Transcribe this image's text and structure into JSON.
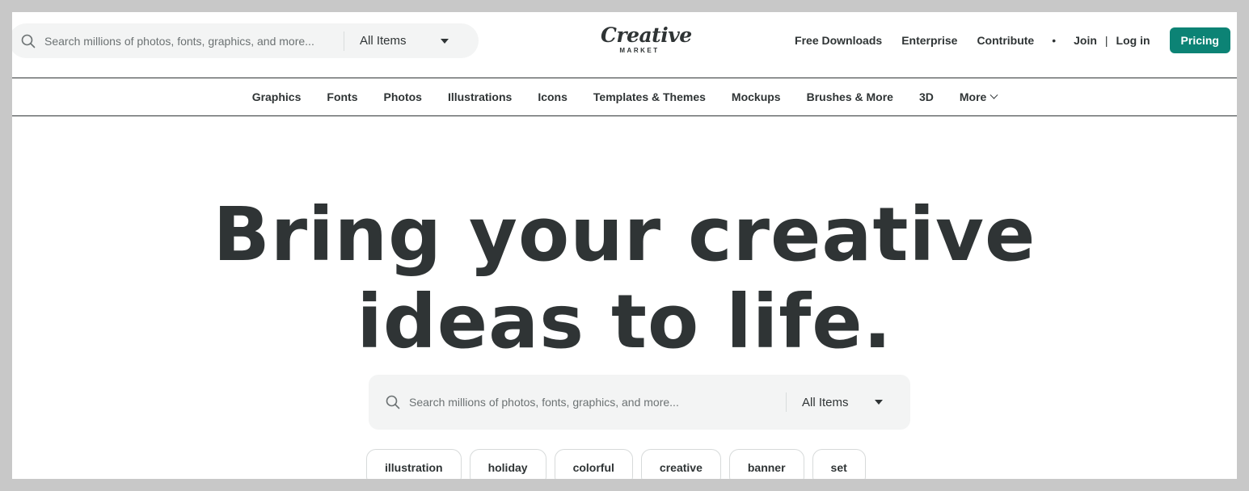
{
  "header": {
    "search": {
      "placeholder": "Search millions of photos, fonts, graphics, and more...",
      "category": "All Items"
    },
    "logo": {
      "main": "Creative",
      "sub": "MARKET"
    },
    "links": {
      "free_downloads": "Free Downloads",
      "enterprise": "Enterprise",
      "contribute": "Contribute",
      "dot": "•",
      "join": "Join",
      "pipe": "|",
      "login": "Log in",
      "pricing": "Pricing"
    }
  },
  "nav": {
    "items": [
      "Graphics",
      "Fonts",
      "Photos",
      "Illustrations",
      "Icons",
      "Templates & Themes",
      "Mockups",
      "Brushes & More",
      "3D"
    ],
    "more": "More"
  },
  "hero": {
    "title_line1": "Bring your creative",
    "title_line2": "ideas to life.",
    "search": {
      "placeholder": "Search millions of photos, fonts, graphics, and more...",
      "category": "All Items"
    },
    "chips": [
      "illustration",
      "holiday",
      "colorful",
      "creative",
      "banner",
      "set"
    ]
  },
  "colors": {
    "accent": "#0c8375",
    "text": "#2f3435",
    "search_bg": "#f3f4f4"
  },
  "icons": {
    "search": "search-icon",
    "caret": "caret-down-icon",
    "more": "chevron-down-icon"
  }
}
